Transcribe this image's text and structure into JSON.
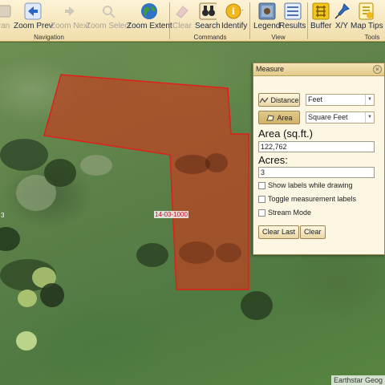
{
  "toolbar": {
    "buttons": [
      {
        "label": "ran",
        "icon": "partial-tool-icon",
        "enabled": false
      },
      {
        "label": "Zoom Prev",
        "icon": "arrow-left-icon",
        "enabled": true
      },
      {
        "label": "Zoom Next",
        "icon": "arrow-right-icon",
        "enabled": false
      },
      {
        "label": "Zoom Select",
        "icon": "zoom-select-icon",
        "enabled": false
      },
      {
        "label": "Zoom Extent",
        "icon": "globe-icon",
        "enabled": true
      },
      {
        "label": "Clear",
        "icon": "eraser-icon",
        "enabled": false
      },
      {
        "label": "Search",
        "icon": "binoculars-icon",
        "enabled": true
      },
      {
        "label": "Identify",
        "icon": "info-icon",
        "enabled": true
      },
      {
        "label": "Legend",
        "icon": "legend-icon",
        "enabled": true
      },
      {
        "label": "Results",
        "icon": "results-icon",
        "enabled": true
      },
      {
        "label": "Buffer",
        "icon": "buffer-icon",
        "enabled": true
      },
      {
        "label": "X/Y",
        "icon": "pin-icon",
        "enabled": true
      },
      {
        "label": "Map Tips",
        "icon": "map-tips-icon",
        "enabled": true
      }
    ],
    "groups": {
      "navigation": "Navigation",
      "commands": "Commands",
      "view": "View",
      "tools": "Tools"
    }
  },
  "map": {
    "parcel_label": "14-03-1000",
    "side_label": "3",
    "attribution": "Earthstar Geog",
    "parcel_fill": "#c0401f",
    "parcel_stroke": "#e0201a"
  },
  "measure": {
    "title": "Measure",
    "close_glyph": "×",
    "distance_button": "Distance",
    "distance_unit": "Feet",
    "area_button": "Area",
    "area_unit": "Square Feet",
    "area_heading": "Area (sq.ft.)",
    "area_value": "122,762",
    "acres_heading": "Acres:",
    "acres_value": "3",
    "options": [
      {
        "label": "Show labels while drawing",
        "checked": false
      },
      {
        "label": "Toggle measurement labels",
        "checked": false
      },
      {
        "label": "Stream Mode",
        "checked": false
      }
    ],
    "clear_last_button": "Clear Last",
    "clear_button": "Clear"
  }
}
